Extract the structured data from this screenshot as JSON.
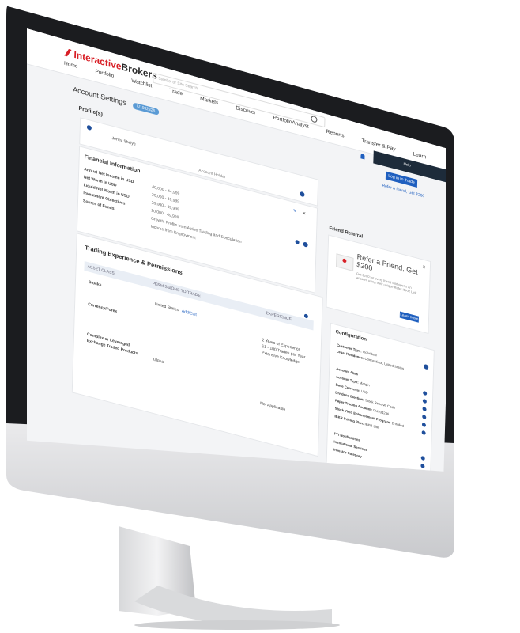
{
  "app": {
    "brand_prefix": "Interactive",
    "brand_suffix": "Brokers",
    "search_placeholder": "Symbol or Site Search"
  },
  "nav": [
    "Home",
    "Portfolio",
    "Watchlist",
    "Trade",
    "Markets",
    "Discover",
    "PortfolioAnalyst",
    "Reports",
    "Transfer & Pay",
    "Learn"
  ],
  "header": {
    "help": "Help",
    "login_label": "Log in to Trade",
    "refer_link": "Refer a friend, Get $200"
  },
  "page": {
    "title": "Account Settings",
    "badge": "U1902325",
    "profiles_heading": "Profile(s)",
    "profile_name": "Jenny Shelye",
    "account_holder": "Account Holder"
  },
  "financial": {
    "title": "Financial Information",
    "rows": [
      {
        "label": "Annual Net Income in USD",
        "value": "40,000 - 44,999"
      },
      {
        "label": "Net Worth in USD",
        "value": "20,000 - 49,999"
      },
      {
        "label": "Liquid Net Worth in USD",
        "value": "20,000 - 49,999"
      },
      {
        "label": "Investment Objectives",
        "value": "20,000 - 49,999"
      },
      {
        "label": "Source of Funds",
        "value": "Growth, Profits from Active Trading and Speculation"
      },
      {
        "label": "",
        "value": "Income from Employment"
      }
    ]
  },
  "trading": {
    "title": "Trading Experience & Permissions",
    "col_asset": "ASSET CLASS",
    "col_permissions": "PERMISSIONS TO TRADE",
    "col_experience": "EXPERIENCE",
    "stocks": "Stocks",
    "stocks_region": "United States",
    "add_edit": "Add/Edit",
    "experience_lines": [
      "2 Years of Experience",
      "51 - 100 Trades per Year",
      "Extensive Knowledge"
    ],
    "currency": "Currency/Forex",
    "complex_1": "Complex or Leveraged",
    "complex_2": "Exchange Traded Products",
    "complex_region": "Global",
    "not_applicable": "Not Applicable"
  },
  "referral": {
    "heading": "Friend Referral",
    "title": "Refer a Friend, Get $200",
    "subtitle": "Get $200 for every friend that opens an account using their unique Refer IBKR Link",
    "learn_more": "Learn More",
    "close": "x"
  },
  "config": {
    "title": "Configuration",
    "customer_type_label": "Customer Type:",
    "customer_type": "Individual",
    "legal_residence_label": "Legal Residence:",
    "legal_residence": "Connecticut, United States",
    "account_alias": "Account Alias",
    "account_type_label": "Account Type:",
    "account_type": "Margin",
    "base_currency_label": "Base Currency:",
    "base_currency": "USD",
    "dividend_label": "Dividend Election:",
    "dividend": "Stock Receive Cash",
    "paper_label": "Paper Trading Account:",
    "paper": "DU934236",
    "yield_label": "Stock Yield Enhancement Program:",
    "yield": "Enrolled",
    "pricing_label": "IBKR Pricing Plan:",
    "pricing": "IBKR Lite",
    "items": [
      "FYI Notifications",
      "Institutional Services",
      "Investor Category"
    ]
  }
}
